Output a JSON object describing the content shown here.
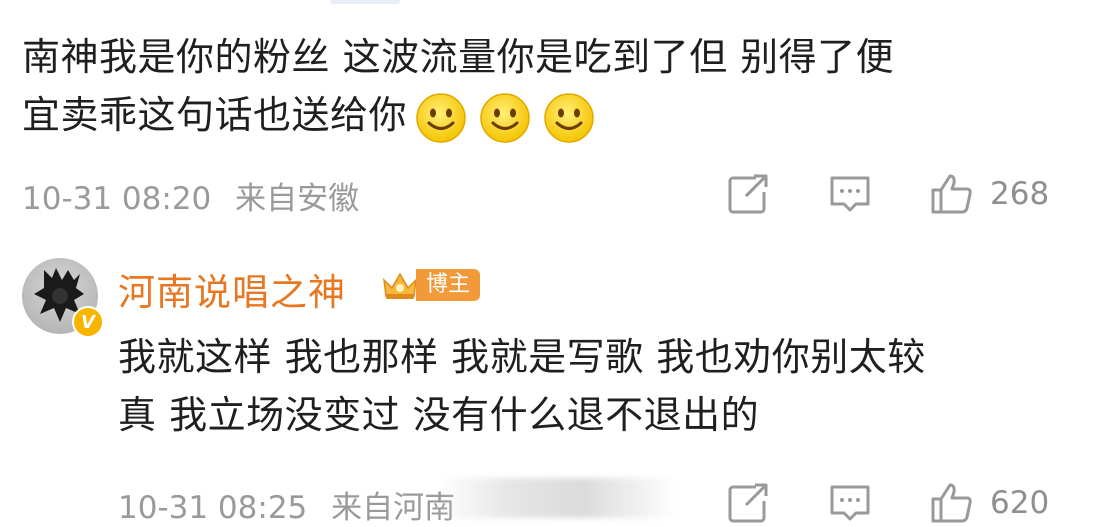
{
  "comment": {
    "text_line1": "南神我是你的粉丝 这波流量你是吃到了但 别得了便",
    "text_line2": "宜卖乖这句话也送给你",
    "emojis": [
      "smile-emoji",
      "smile-emoji",
      "smile-emoji"
    ],
    "timestamp": "10-31 08:20",
    "location": "来自安徽",
    "like_count": "268"
  },
  "reply": {
    "username": "河南说唱之神",
    "badge_label": "博主",
    "verified_mark": "V",
    "text_line1": "我就这样 我也那样 我就是写歌 我也劝你别太较",
    "text_line2": "真 我立场没变过 没有什么退不退出的",
    "timestamp": "10-31 08:25",
    "location": "来自河南",
    "like_count": "620"
  },
  "colors": {
    "username": "#e87722",
    "meta_gray": "#9a9a9a",
    "badge_orange": "#f29a3a",
    "verified_yellow": "#f7b500"
  },
  "icons": [
    "share-icon",
    "comment-icon",
    "like-icon",
    "crown-icon"
  ]
}
